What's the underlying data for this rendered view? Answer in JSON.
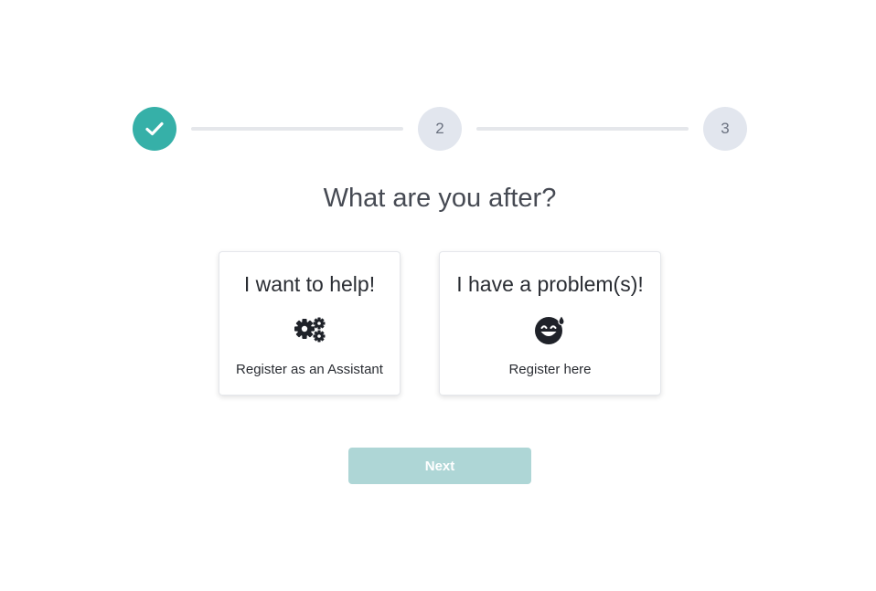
{
  "stepper": {
    "steps": [
      {
        "label": "",
        "status": "completed",
        "icon": "check-icon"
      },
      {
        "label": "2",
        "status": "pending"
      },
      {
        "label": "3",
        "status": "pending"
      }
    ],
    "accent_color": "#36b0a8",
    "pending_color": "#e2e6ee"
  },
  "title": "What are you after?",
  "options": [
    {
      "heading": "I want to help!",
      "icon": "gears-icon",
      "subtitle": "Register as an Assistant"
    },
    {
      "heading": "I have a problem(s)!",
      "icon": "grin-sweat-icon",
      "subtitle": "Register here"
    }
  ],
  "next_button": {
    "label": "Next",
    "color": "#aed6d6"
  }
}
